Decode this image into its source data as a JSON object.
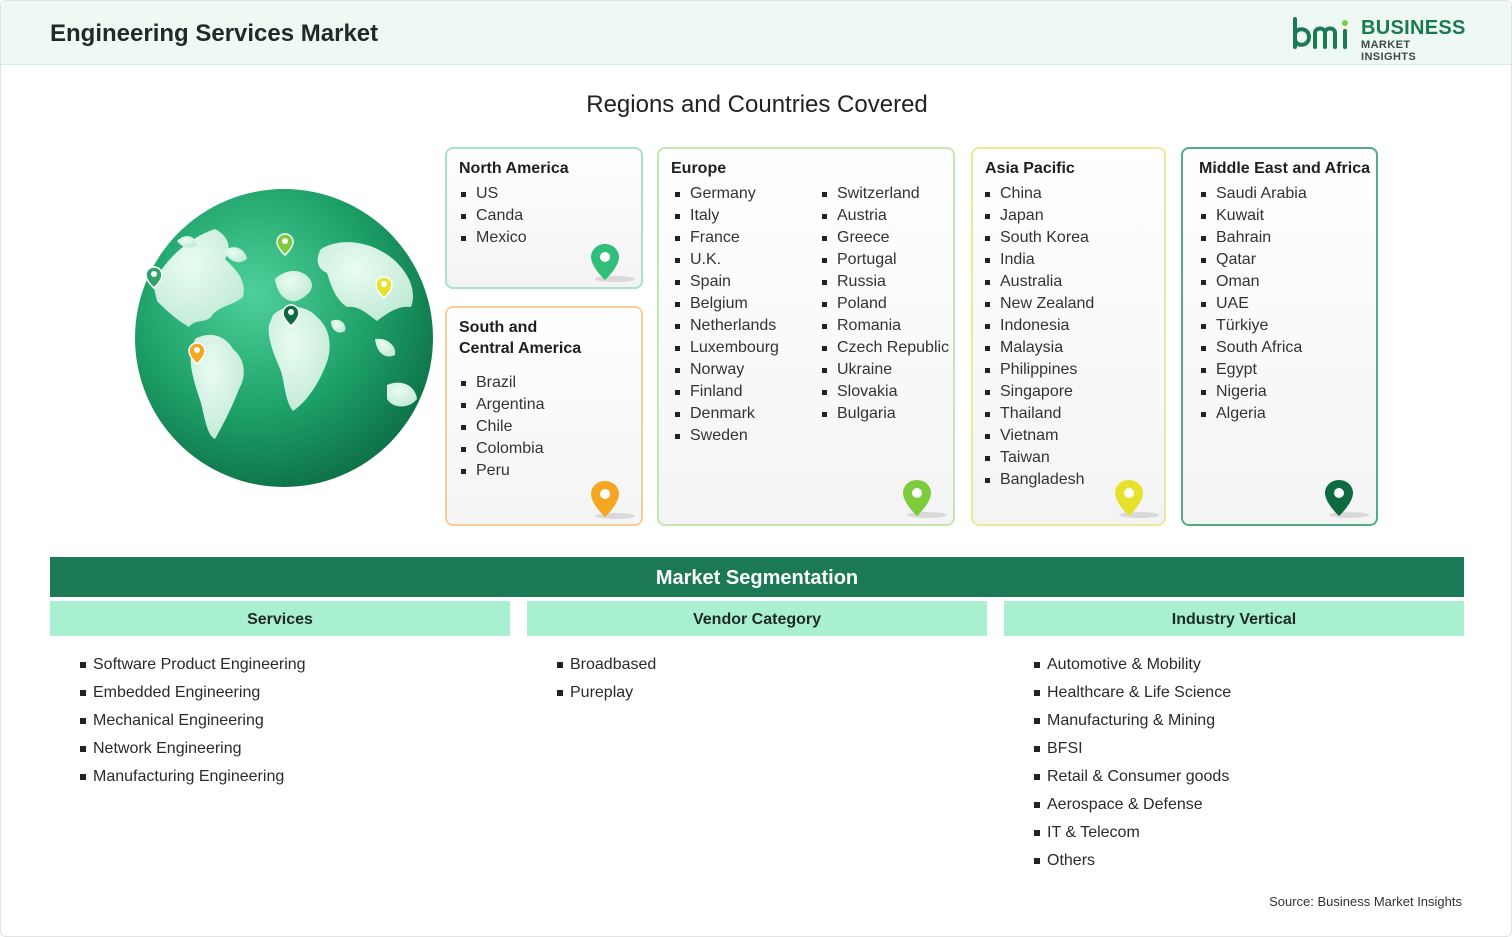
{
  "header": {
    "title": "Engineering Services Market"
  },
  "logo": {
    "line1": "BUSINESS",
    "line2": "MARKET INSIGHTS",
    "icon": "bmi-logo-icon"
  },
  "regions": {
    "title": "Regions and Countries Covered",
    "north_america": {
      "name": "North America",
      "countries": [
        "US",
        "Canda",
        "Mexico"
      ]
    },
    "south_america": {
      "name_line1": "South and",
      "name_line2": "Central America",
      "countries": [
        "Brazil",
        "Argentina",
        "Chile",
        "Colombia",
        "Peru"
      ]
    },
    "europe": {
      "name": "Europe",
      "countries_col1": [
        "Germany",
        "Italy",
        "France",
        "U.K.",
        "Spain",
        "Belgium",
        "Netherlands",
        "Luxembourg",
        "Norway",
        "Finland",
        "Denmark",
        "Sweden"
      ],
      "countries_col2": [
        "Switzerland",
        "Austria",
        "Greece",
        "Portugal",
        "Russia",
        "Poland",
        "Romania",
        "Czech Republic",
        "Ukraine",
        "Slovakia",
        "Bulgaria"
      ]
    },
    "asia_pacific": {
      "name": "Asia Pacific",
      "countries": [
        "China",
        "Japan",
        "South Korea",
        "India",
        "Australia",
        "New Zealand",
        "Indonesia",
        "Malaysia",
        "Philippines",
        "Singapore",
        "Thailand",
        "Vietnam",
        "Taiwan",
        "Bangladesh"
      ]
    },
    "middle_east_africa": {
      "name": "Middle East and Africa",
      "countries": [
        "Saudi Arabia",
        "Kuwait",
        "Bahrain",
        "Qatar",
        "Oman",
        "UAE",
        "Türkiye",
        "South Africa",
        "Egypt",
        "Nigeria",
        "Algeria"
      ]
    }
  },
  "segmentation": {
    "title": "Market Segmentation",
    "services": {
      "heading": "Services",
      "items": [
        "Software Product Engineering",
        "Embedded Engineering",
        "Mechanical Engineering",
        "Network Engineering",
        "Manufacturing Engineering"
      ]
    },
    "vendor_category": {
      "heading": "Vendor Category",
      "items": [
        "Broadbased",
        "Pureplay"
      ]
    },
    "industry_vertical": {
      "heading": "Industry Vertical",
      "items": [
        "Automotive & Mobility",
        "Healthcare & Life Science",
        "Manufacturing & Mining",
        "BFSI",
        "Retail & Consumer goods",
        "Aerospace & Defense",
        "IT & Telecom",
        "Others"
      ]
    }
  },
  "source": "Source: Business Market Insights",
  "colors": {
    "brand_green": "#1b7a55",
    "mint": "#a8f0cf",
    "orange_pin": "#f5a623",
    "yellow_pin": "#e6e12a",
    "light_green_pin": "#7ccc3c"
  }
}
